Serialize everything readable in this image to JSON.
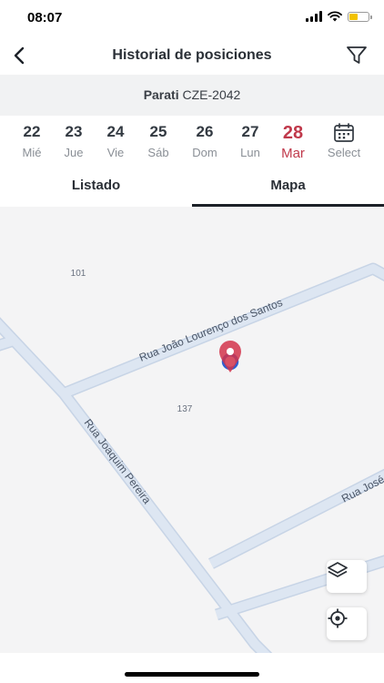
{
  "status_bar": {
    "time": "08:07"
  },
  "header": {
    "title": "Historial de posiciones"
  },
  "vehicle": {
    "name": "Parati",
    "plate": "CZE-2042"
  },
  "days": [
    {
      "num": "22",
      "name": "Mié"
    },
    {
      "num": "23",
      "name": "Jue"
    },
    {
      "num": "24",
      "name": "Vie"
    },
    {
      "num": "25",
      "name": "Sáb"
    },
    {
      "num": "26",
      "name": "Dom"
    },
    {
      "num": "27",
      "name": "Lun"
    },
    {
      "num": "28",
      "name": "Mar",
      "active": true
    }
  ],
  "calendar": {
    "label": "Select"
  },
  "tabs": [
    {
      "label": "Listado",
      "active": false
    },
    {
      "label": "Mapa",
      "active": true
    }
  ],
  "map": {
    "streets": {
      "rua_joao": "Rua João Lourenço dos Santos",
      "rua_joaquim": "Rua Joaquim Pereira",
      "rua_jose": "Rua José"
    },
    "numbers": {
      "lot_a": "101",
      "lot_b": "137"
    }
  },
  "colors": {
    "accent": "#c0394b",
    "road": "#dde6f2",
    "road_edge": "#c7d4e6",
    "pin_ring": "#2f5fd0"
  }
}
